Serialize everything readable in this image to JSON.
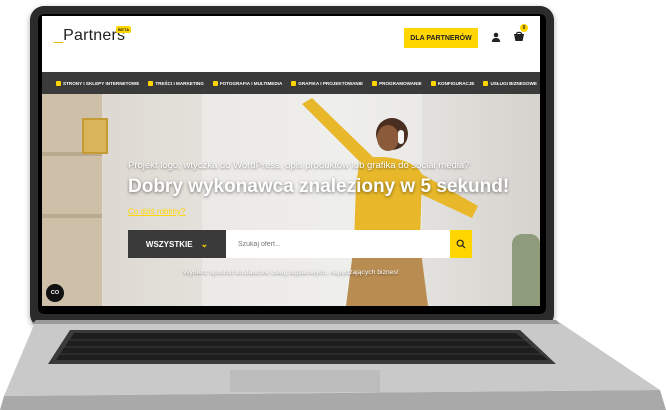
{
  "header": {
    "logo_text": "Partners",
    "logo_badge": "BETA",
    "cta_label": "DLA PARTNERÓW",
    "cart_count": "0"
  },
  "nav": {
    "items": [
      {
        "label": "STRONY I SKLEPY INTERNETOWE",
        "icon": "monitor-icon"
      },
      {
        "label": "TREŚCI I MARKETING",
        "icon": "pen-icon"
      },
      {
        "label": "FOTOGRAFIA I MULTIMEDIA",
        "icon": "camera-icon"
      },
      {
        "label": "GRAFIKA I PROJEKTOWANIE",
        "icon": "image-icon"
      },
      {
        "label": "PROGRAMOWANIE",
        "icon": "code-icon"
      },
      {
        "label": "KONFIGURACJE",
        "icon": "settings-icon"
      },
      {
        "label": "USŁUGI BIZNESOWE",
        "icon": "person-icon"
      }
    ]
  },
  "hero": {
    "subtitle": "Projekt logo, wtyczka do WordPress, opis produktów lub grafika do social media?",
    "title": "Dobry wykonawca znaleziony w 5 sekund!",
    "link": "Co dziś robimy?",
    "select_value": "WSZYSTKIE",
    "search_placeholder": "Szukaj ofert...",
    "note": "Wybierz spośród dostawców usług digitalowych, napędzających biznes!",
    "cookie_label": "CO"
  },
  "colors": {
    "accent": "#ffd600",
    "dark": "#3a3a3a"
  }
}
